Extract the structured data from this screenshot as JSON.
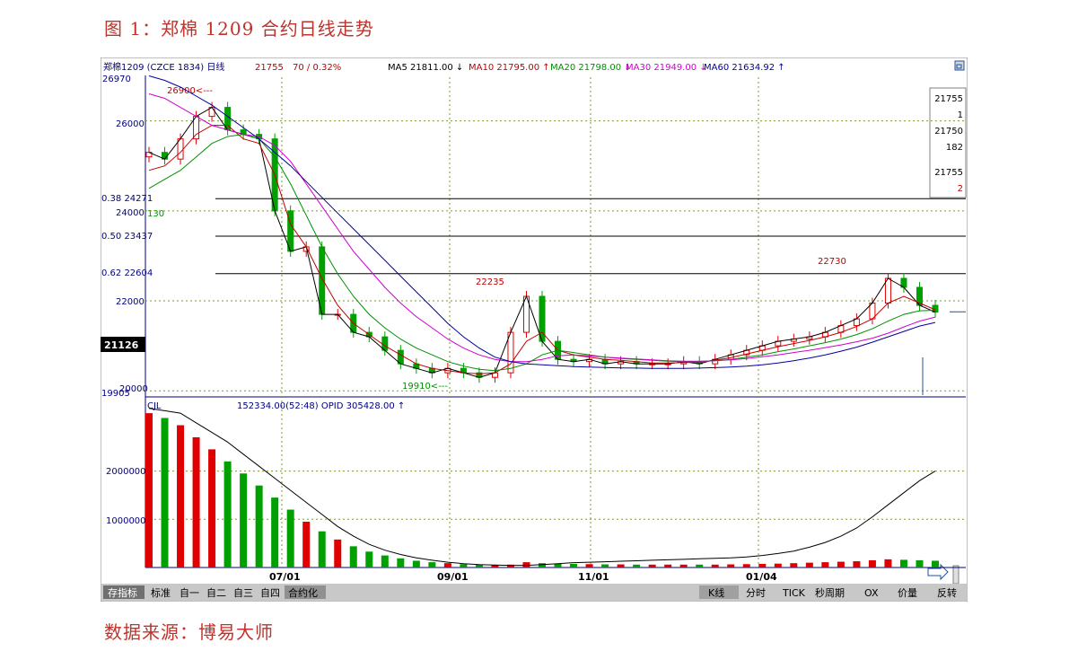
{
  "figure_title": "图 1：郑棉 1209 合约日线走势",
  "source_note": "数据来源：博易大师",
  "window_icon": "restore-window-icon",
  "header": {
    "symbol": "郑棉1209 (CZCE  1834) 日线",
    "last": "21755",
    "change": "70 / 0.32%",
    "ma5": "MA5 21811.00 ↓",
    "ma10": "MA10 21795.00 ↑",
    "ma20": "MA20 21798.00 ↓",
    "ma30": "MA30 21949.00 ↓",
    "ma60": "MA60  21634.92 ↑"
  },
  "quote_box": [
    "21755",
    "1",
    "21750",
    "182",
    "21755",
    "2"
  ],
  "price_axis": {
    "top_label": "26970",
    "bottom_label": "19905",
    "current_label": "21126",
    "ticks": [
      "26000",
      "24000",
      "22000",
      "20000"
    ]
  },
  "fib_lines": [
    {
      "label": "0.38 24271",
      "value": 24271
    },
    {
      "label": "0.50 23437",
      "value": 23437
    },
    {
      "label": "0.62 22604",
      "value": 22604
    }
  ],
  "annotations": {
    "high": "26900<---",
    "left_low": "130",
    "low": "19910<---",
    "peak1": "22235",
    "peak2": "22730"
  },
  "volume_header": {
    "name": "CJL",
    "values": "152334.00(52:48)   OPID   305428.00 ↑"
  },
  "volume_axis": {
    "ticks": [
      "2000000",
      "1000000"
    ]
  },
  "x_axis": {
    "ticks": [
      "07/01",
      "09/01",
      "11/01",
      "01/04"
    ]
  },
  "toolbar": {
    "left": [
      "存指标",
      "标准",
      "自一",
      "自二",
      "自三",
      "自四",
      "合约化"
    ],
    "right": [
      "K线",
      "分时",
      "TICK",
      "秒周期",
      "OX",
      "价量",
      "反转"
    ]
  },
  "colors": {
    "title": "#c0322b",
    "up": "#e00000",
    "down": "#00a000",
    "ma5": "#000000",
    "ma10": "#c00000",
    "ma20": "#009000",
    "ma30": "#d000d0",
    "ma60": "#0000a0",
    "grid": "#7a9a30"
  },
  "chart_data": {
    "type": "candlestick",
    "series": [
      {
        "name": "MA5",
        "values": [
          25300,
          25150,
          25600,
          26100,
          26300,
          25800,
          25700,
          25600,
          24000,
          23100,
          23200,
          21700,
          21700,
          21300,
          21200,
          20900,
          20600,
          20500,
          20400,
          20500,
          20400,
          20300,
          20400,
          21300,
          22100,
          21100,
          20700,
          20650,
          20700,
          20600,
          20650,
          20600,
          20600,
          20600,
          20650,
          20600,
          20700,
          20800,
          20900,
          21000,
          21100,
          21150,
          21200,
          21300,
          21450,
          21600,
          21950,
          22500,
          22300,
          21900,
          21750
        ]
      },
      {
        "name": "MA10",
        "values": [
          24900,
          25000,
          25300,
          25700,
          25900,
          25900,
          25600,
          25500,
          24800,
          23700,
          23200,
          22500,
          21900,
          21500,
          21250,
          21000,
          20800,
          20600,
          20500,
          20450,
          20400,
          20380,
          20400,
          20600,
          21100,
          21300,
          20900,
          20800,
          20750,
          20700,
          20680,
          20650,
          20620,
          20620,
          20630,
          20640,
          20680,
          20740,
          20820,
          20900,
          20980,
          21050,
          21120,
          21200,
          21300,
          21430,
          21600,
          21950,
          22100,
          21950,
          21800
        ]
      },
      {
        "name": "MA20",
        "values": [
          24500,
          24700,
          24900,
          25200,
          25500,
          25650,
          25700,
          25600,
          25200,
          24600,
          23900,
          23200,
          22600,
          22100,
          21700,
          21400,
          21150,
          20950,
          20800,
          20650,
          20550,
          20480,
          20450,
          20500,
          20600,
          20800,
          20900,
          20850,
          20800,
          20750,
          20720,
          20700,
          20680,
          20660,
          20650,
          20650,
          20670,
          20700,
          20750,
          20800,
          20870,
          20930,
          21000,
          21070,
          21150,
          21250,
          21380,
          21550,
          21700,
          21780,
          21790
        ]
      },
      {
        "name": "MA30",
        "values": [
          26600,
          26500,
          26300,
          26100,
          25900,
          25800,
          25700,
          25650,
          25450,
          25100,
          24600,
          24100,
          23600,
          23100,
          22700,
          22300,
          21950,
          21650,
          21400,
          21150,
          20950,
          20800,
          20700,
          20650,
          20650,
          20700,
          20780,
          20800,
          20780,
          20750,
          20730,
          20710,
          20690,
          20670,
          20660,
          20660,
          20670,
          20690,
          20720,
          20760,
          20800,
          20850,
          20900,
          20960,
          21020,
          21090,
          21170,
          21280,
          21420,
          21550,
          21640
        ]
      },
      {
        "name": "MA60",
        "values": [
          27000,
          26900,
          26750,
          26550,
          26350,
          26100,
          25850,
          25600,
          25300,
          25000,
          24650,
          24300,
          23950,
          23600,
          23250,
          22900,
          22550,
          22200,
          21850,
          21500,
          21200,
          20950,
          20750,
          20650,
          20600,
          20580,
          20560,
          20540,
          20530,
          20520,
          20510,
          20505,
          20500,
          20500,
          20500,
          20505,
          20515,
          20530,
          20550,
          20580,
          20620,
          20670,
          20730,
          20800,
          20880,
          20970,
          21080,
          21200,
          21320,
          21440,
          21520
        ]
      },
      {
        "name": "OPID",
        "values": [
          3300000,
          3250000,
          3200000,
          3000000,
          2800000,
          2600000,
          2350000,
          2100000,
          1850000,
          1600000,
          1350000,
          1100000,
          850000,
          650000,
          480000,
          360000,
          270000,
          200000,
          150000,
          110000,
          80000,
          60000,
          50000,
          45000,
          45000,
          60000,
          80000,
          100000,
          110000,
          120000,
          130000,
          140000,
          150000,
          160000,
          170000,
          180000,
          190000,
          200000,
          220000,
          250000,
          290000,
          340000,
          420000,
          520000,
          650000,
          820000,
          1050000,
          1300000,
          1550000,
          1800000,
          2000000
        ]
      }
    ],
    "volume": [
      3200000,
      3100000,
      2950000,
      2700000,
      2450000,
      2200000,
      1950000,
      1700000,
      1450000,
      1200000,
      950000,
      750000,
      580000,
      440000,
      330000,
      250000,
      190000,
      140000,
      110000,
      90000,
      70000,
      60000,
      55000,
      60000,
      110000,
      90000,
      80000,
      75000,
      70000,
      65000,
      65000,
      60000,
      60000,
      60000,
      60000,
      60000,
      60000,
      65000,
      70000,
      75000,
      80000,
      90000,
      100000,
      110000,
      120000,
      130000,
      150000,
      170000,
      160000,
      150000,
      140000
    ],
    "x_ticks": [
      "07/01",
      "09/01",
      "11/01",
      "01/04"
    ],
    "y_ticks": [
      26000,
      24000,
      22000,
      20000
    ],
    "ylim": [
      19905,
      26970
    ],
    "fib_levels": [
      24271,
      23437,
      22604
    ],
    "markers": {
      "high": 26900,
      "low": 19910,
      "peak1": 22235,
      "peak2": 22730
    }
  }
}
